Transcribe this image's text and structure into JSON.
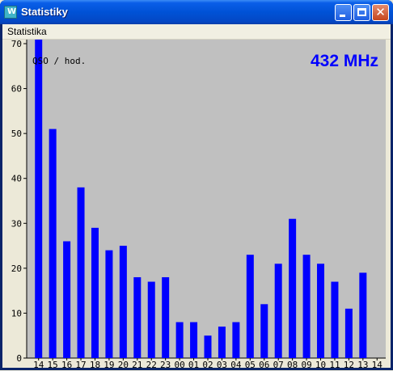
{
  "window": {
    "title": "Statistiky",
    "icon_text": "W"
  },
  "menu": {
    "items": [
      "Statistika"
    ]
  },
  "chart_data": {
    "type": "bar",
    "title": "432 MHz",
    "ylabel": "QSO / hod.",
    "categories": [
      "14",
      "15",
      "16",
      "17",
      "18",
      "19",
      "20",
      "21",
      "22",
      "23",
      "00",
      "01",
      "02",
      "03",
      "04",
      "05",
      "06",
      "07",
      "08",
      "09",
      "10",
      "11",
      "12",
      "13",
      "14"
    ],
    "values": [
      71,
      51,
      26,
      38,
      29,
      24,
      25,
      18,
      17,
      18,
      8,
      8,
      5,
      7,
      8,
      23,
      12,
      21,
      31,
      23,
      21,
      17,
      11,
      19,
      0
    ],
    "ylim": [
      0,
      70
    ],
    "yticks": [
      0,
      10,
      20,
      30,
      40,
      50,
      60,
      70
    ],
    "colors": {
      "bar": "#0000ff",
      "background": "#c0c0c0",
      "title": "#0000ff"
    }
  }
}
